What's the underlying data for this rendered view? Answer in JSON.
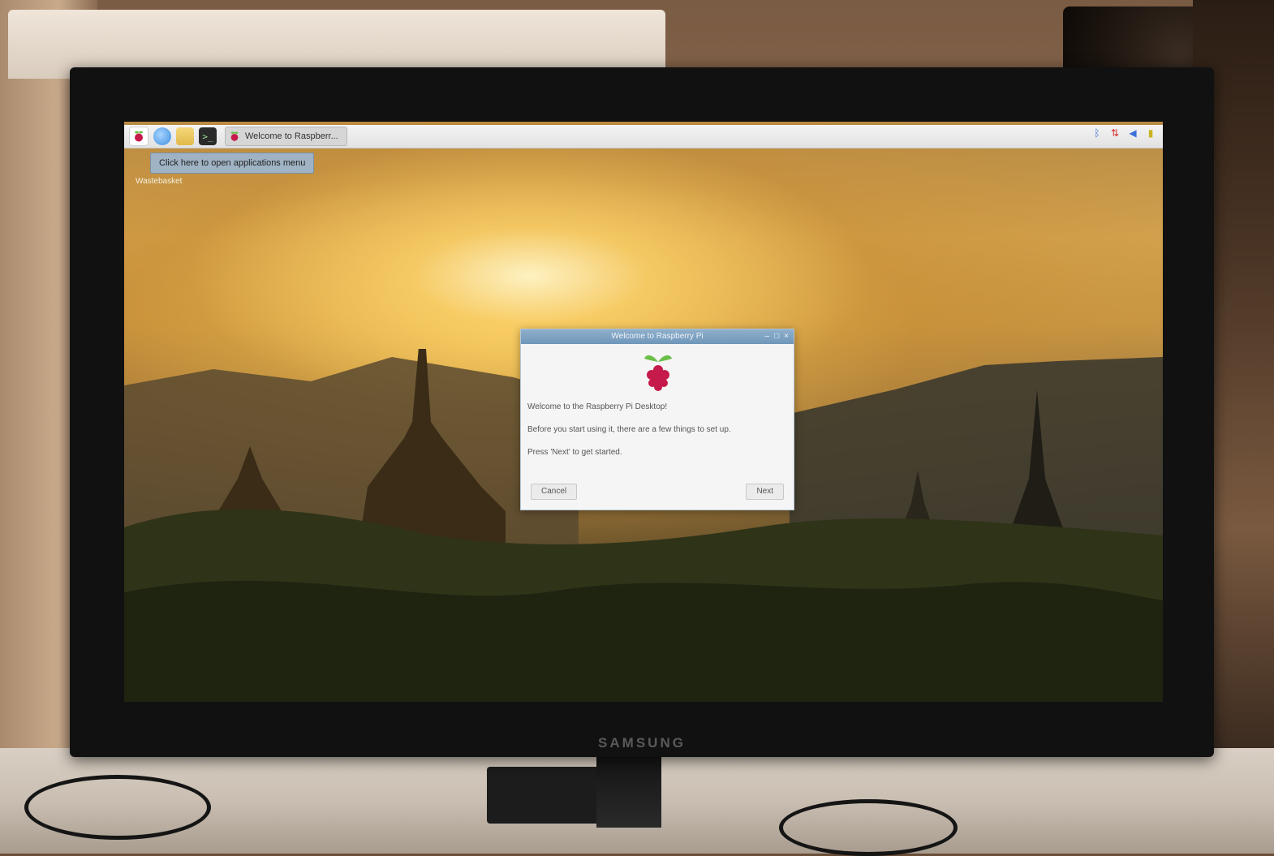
{
  "taskbar": {
    "window_button_label": "Welcome to Raspberr...",
    "tooltip": "Click here to open applications menu",
    "terminal_glyph": ">_"
  },
  "desktop": {
    "label": "Wastebasket"
  },
  "dialog": {
    "title": "Welcome to Raspberry Pi",
    "line1": "Welcome to the Raspberry Pi Desktop!",
    "line2": "Before you start using it, there are a few things to set up.",
    "line3": "Press 'Next' to get started.",
    "cancel_label": "Cancel",
    "next_label": "Next",
    "minimize_glyph": "–",
    "maximize_glyph": "□",
    "close_glyph": "×"
  },
  "monitor": {
    "brand": "SAMSUNG"
  },
  "colors": {
    "raspberry_red": "#c51a4a",
    "leaf_green": "#6cc04a",
    "titlebar_blue": "#7aa0c2"
  },
  "icons": [
    "raspberry-icon",
    "web-browser-icon",
    "file-manager-icon",
    "terminal-icon",
    "bluetooth-icon",
    "network-icon",
    "volume-icon",
    "battery-icon"
  ]
}
